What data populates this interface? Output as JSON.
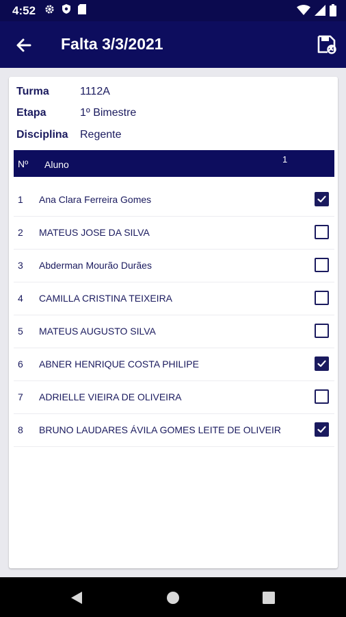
{
  "status_bar": {
    "time": "4:52",
    "left_icons": [
      "gear-icon",
      "shield-icon",
      "sd-card-icon"
    ],
    "right_icons": [
      "wifi-icon",
      "signal-icon",
      "battery-icon"
    ]
  },
  "app_bar": {
    "title": "Falta 3/3/2021",
    "back_icon": "arrow-left-icon",
    "save_icon": "save-icon"
  },
  "info": {
    "turma_label": "Turma",
    "turma_value": "1112A",
    "etapa_label": "Etapa",
    "etapa_value": "1º Bimestre",
    "disciplina_label": "Disciplina",
    "disciplina_value": "Regente"
  },
  "table": {
    "header_num": "Nº",
    "header_aluno": "Aluno",
    "header_count": "1",
    "rows": [
      {
        "num": "1",
        "name": "Ana Clara Ferreira Gomes",
        "checked": true
      },
      {
        "num": "2",
        "name": "MATEUS JOSE DA SILVA",
        "checked": false
      },
      {
        "num": "3",
        "name": "Abderman Mourão Durães",
        "checked": false
      },
      {
        "num": "4",
        "name": " CAMILLA CRISTINA TEIXEIRA",
        "checked": false
      },
      {
        "num": "5",
        "name": " MATEUS AUGUSTO SILVA",
        "checked": false
      },
      {
        "num": "6",
        "name": "ABNER HENRIQUE COSTA PHILIPE",
        "checked": true
      },
      {
        "num": "7",
        "name": "ADRIELLE VIEIRA DE OLIVEIRA",
        "checked": false
      },
      {
        "num": "8",
        "name": " BRUNO LAUDARES ÁVILA GOMES LEITE DE OLIVEIR",
        "checked": true
      }
    ]
  },
  "nav_bar": {
    "buttons": [
      "back-triangle-icon",
      "home-circle-icon",
      "recents-square-icon"
    ]
  },
  "colors": {
    "primary": "#0d0d5e",
    "status_bar": "#0b0a4f",
    "text": "#1a1a5e",
    "background": "#e9e9ee"
  }
}
